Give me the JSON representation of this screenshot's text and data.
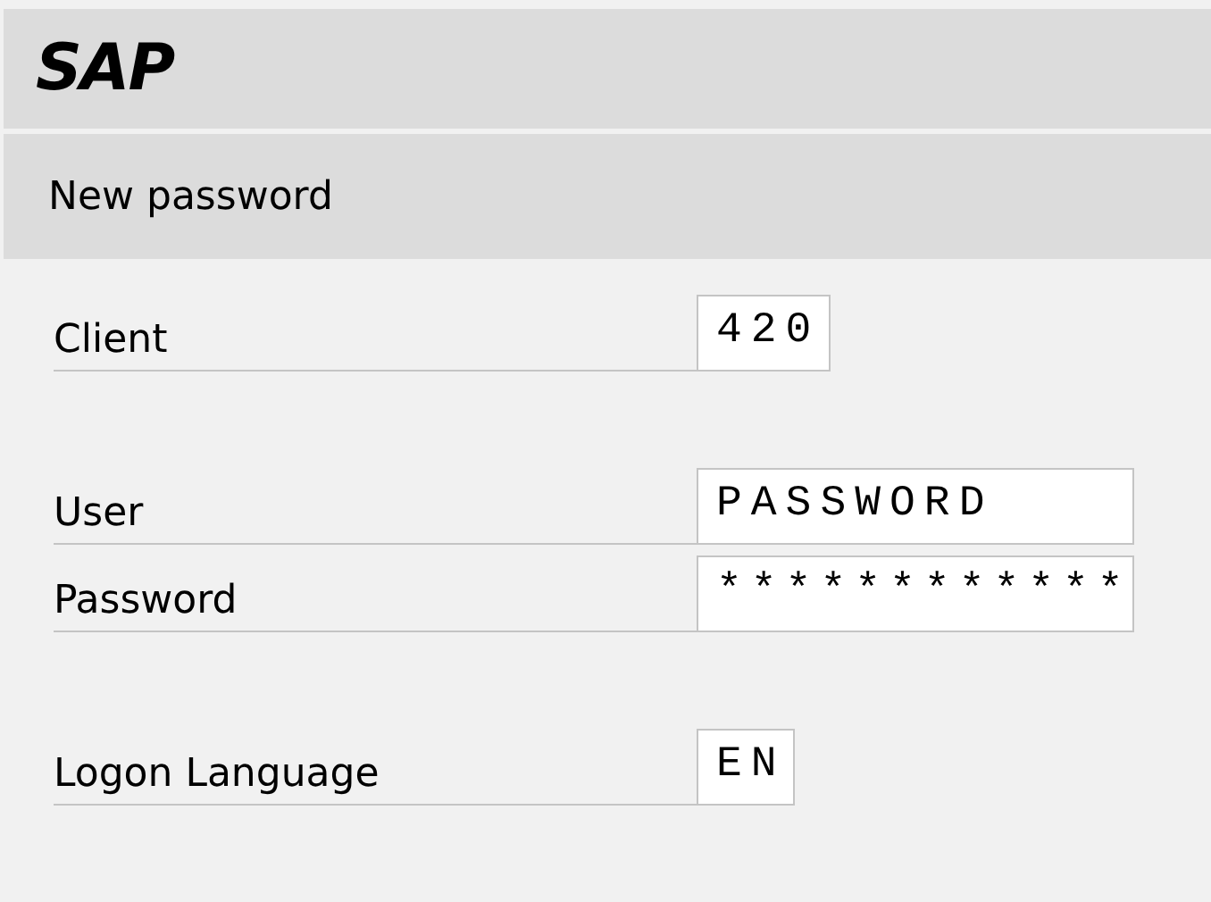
{
  "header": {
    "logo": "SAP"
  },
  "title": "New password",
  "groups": [
    {
      "fields": [
        {
          "label": "Client",
          "value": "420"
        }
      ]
    },
    {
      "fields": [
        {
          "label": "User",
          "value": "PASSWORD"
        },
        {
          "label": "Password",
          "value": "************"
        }
      ]
    },
    {
      "fields": [
        {
          "label": "Logon Language",
          "value": "EN"
        }
      ]
    }
  ]
}
